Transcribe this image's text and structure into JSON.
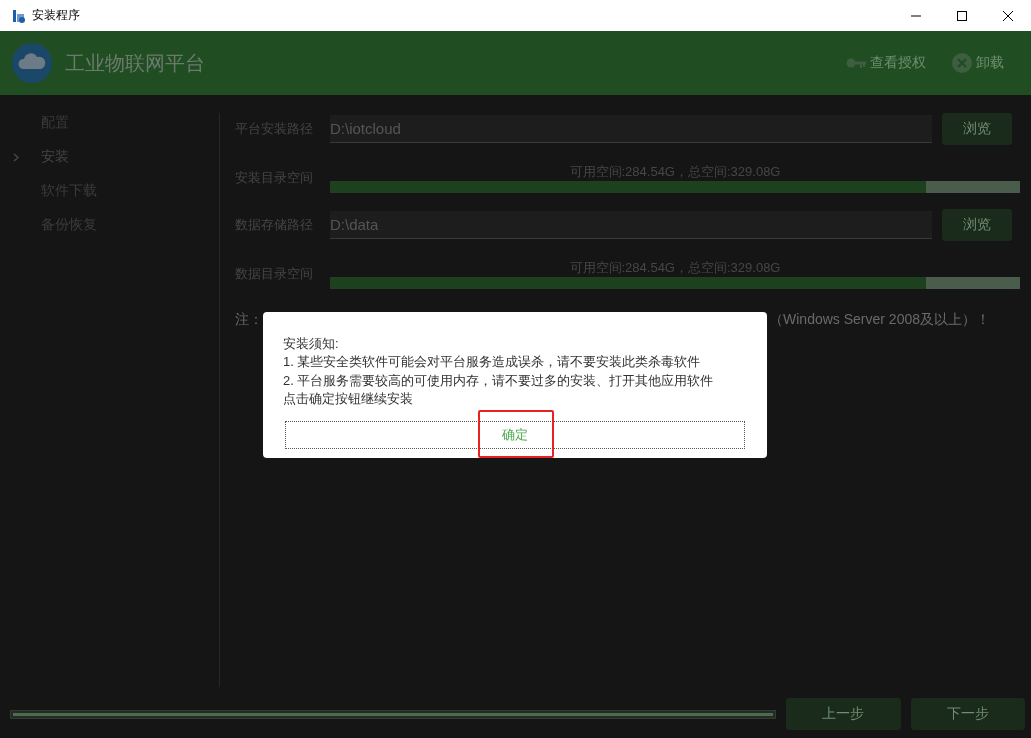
{
  "window": {
    "title": "安装程序"
  },
  "header": {
    "title": "工业物联网平台",
    "actions": [
      {
        "kind": "key",
        "label": "查看授权"
      },
      {
        "kind": "close",
        "label": "卸载"
      }
    ]
  },
  "sidebar": {
    "items": [
      {
        "label": "配置",
        "selected": false
      },
      {
        "label": "安装",
        "selected": true
      },
      {
        "label": "软件下载",
        "selected": false
      },
      {
        "label": "备份恢复",
        "selected": false
      }
    ]
  },
  "form": {
    "rows": [
      {
        "kind": "path",
        "label": "平台安装路径",
        "value": "D:\\iotcloud",
        "button": "浏览"
      },
      {
        "kind": "space",
        "label": "安装目录空间",
        "reading": "可用空间:284.54G，总空间:329.08G",
        "level": 0.864
      },
      {
        "kind": "path",
        "label": "数据存储路径",
        "value": "D:\\data",
        "button": "浏览"
      },
      {
        "kind": "space",
        "label": "数据目录空间",
        "reading": "可用空间:284.54G，总空间:329.08G",
        "level": 0.864
      }
    ],
    "note_start": "注：",
    "note_end": "（Windows Server 2008及以上）！"
  },
  "footer": {
    "progress": {
      "level": 1
    },
    "buttons": [
      "上一步",
      "下一步"
    ]
  },
  "dialog": {
    "lines": [
      "安装须知:",
      "1. 某些安全类软件可能会对平台服务造成误杀，请不要安装此类杀毒软件",
      "2. 平台服务需要较高的可使用内存，请不要过多的安装、打开其他应用软件",
      "点击确定按钮继续安装"
    ],
    "button": "确定",
    "highlighted": true
  }
}
